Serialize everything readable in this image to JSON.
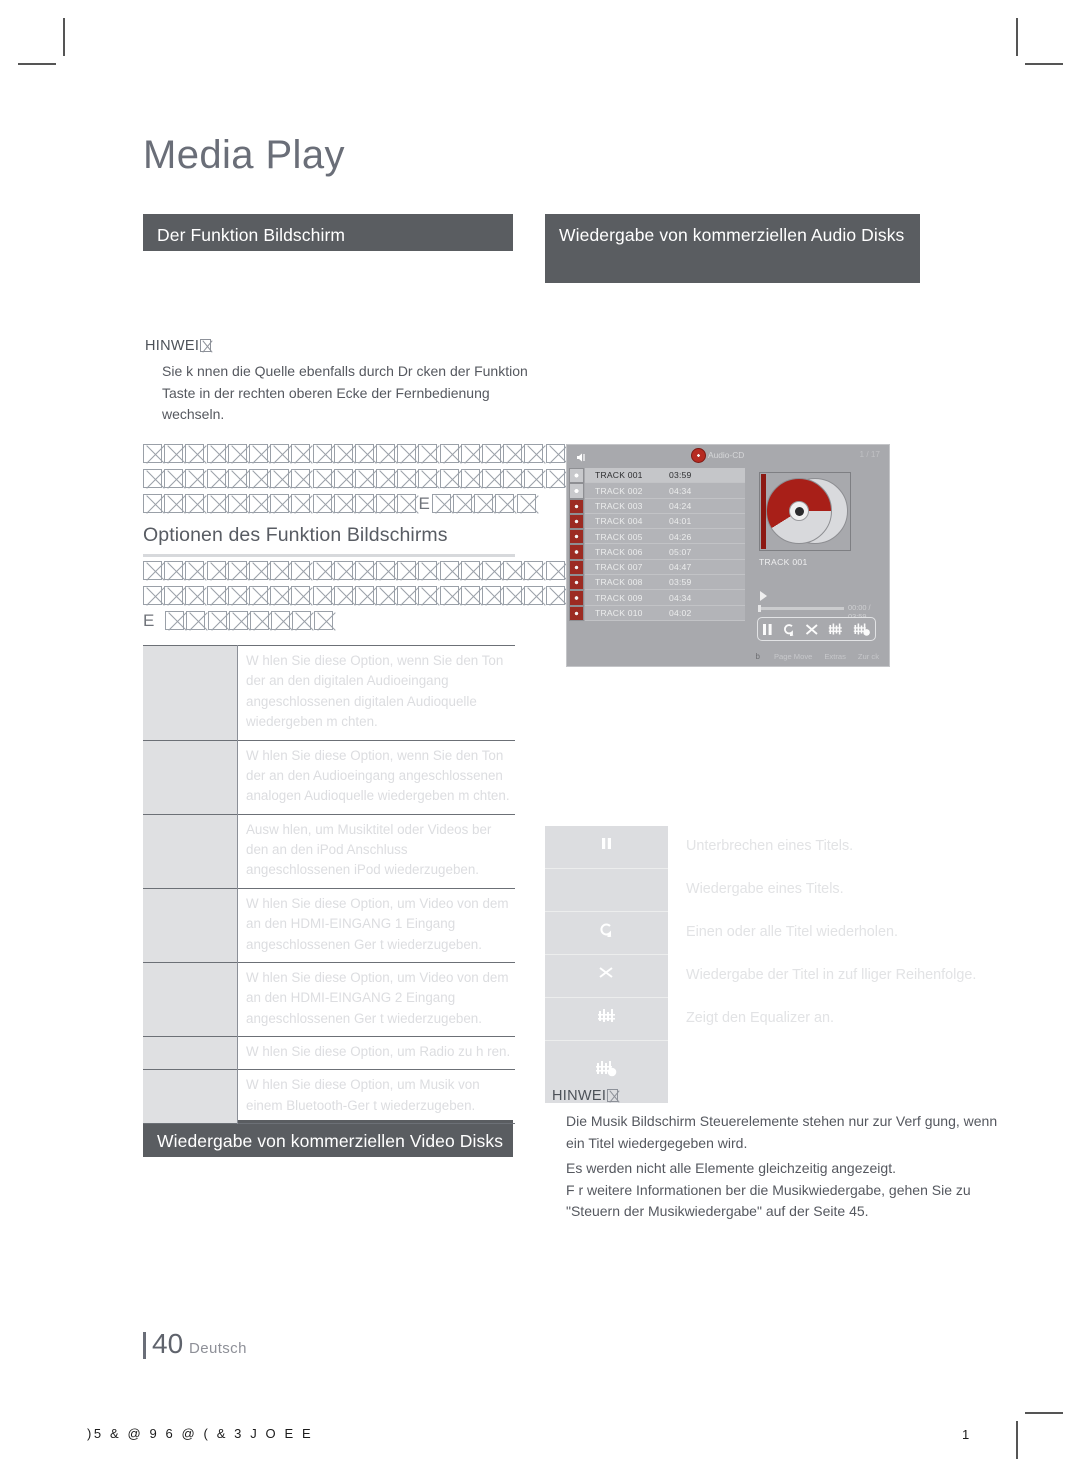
{
  "document": {
    "chapter_title": "Media Play",
    "footer": {
      "page_number": "40",
      "language": "Deutsch",
      "colophon": ")5  &      @ 9 6 @ ( & 3        J O E E",
      "sheet_number": "1"
    }
  },
  "sections": {
    "bar_funktion": "Der Funktion Bildschirm",
    "bar_audio": "Wiedergabe von kommerziellen Audio Disks",
    "bar_video": "Wiedergabe von kommerziellen Video Disks",
    "subhead_optionen": "Optionen des Funktion Bildschirms"
  },
  "notes": {
    "top": {
      "title": "HINWEI",
      "body": "Sie k nnen die Quelle ebenfalls durch Dr cken der Funktion Taste in der rechten oberen Ecke der Fernbedienung wechseln."
    },
    "bottom": {
      "title": "HINWEI",
      "line1": "Die Musik Bildschirm Steuerelemente stehen nur zur Verf gung, wenn ein Titel wiedergegeben wird.",
      "line2": "Es werden nicht alle Elemente gleichzeitig angezeigt.",
      "line3": "F r weitere Informationen  ber die Musikwiedergabe, gehen Sie zu \"Steuern der Musikwiedergabe\" auf der Seite 45."
    }
  },
  "tofu_blocks": {
    "block1": [
      {
        "boxes": 22,
        "letters": []
      },
      {
        "boxes": 23,
        "letters": []
      },
      {
        "boxes": 13,
        "letters": [
          "E"
        ],
        "boxes_after": 5
      }
    ],
    "block2": [
      {
        "boxes": 25,
        "letters": []
      },
      {
        "boxes": 22,
        "letters": []
      },
      {
        "boxes": 0,
        "letters": [
          "E"
        ],
        "boxes_after": 8
      }
    ]
  },
  "options_table": {
    "rows": [
      {
        "key": "",
        "desc": "W hlen Sie diese Option, wenn Sie den Ton der an den digitalen Audioeingang angeschlossenen digitalen Audioquelle wiedergeben m chten."
      },
      {
        "key": "",
        "desc": "W hlen Sie diese Option, wenn Sie den Ton der an den Audioeingang angeschlossenen analogen Audioquelle wiedergeben m chten."
      },
      {
        "key": "",
        "desc": "Ausw hlen, um Musiktitel oder Videos  ber den an den iPod Anschluss angeschlossenen iPod wiederzugeben."
      },
      {
        "key": "",
        "desc": "W hlen Sie diese Option, um Video von dem an den HDMI-EINGANG 1 Eingang angeschlossenen Ger t wiederzugeben."
      },
      {
        "key": "",
        "desc": "W hlen Sie diese Option, um Video von dem an den HDMI-EINGANG 2 Eingang angeschlossenen Ger t wiederzugeben."
      },
      {
        "key": "",
        "desc": "W hlen Sie diese Option, um Radio zu h ren."
      },
      {
        "key": "",
        "desc": "W hlen Sie diese Option, um Musik von einem Bluetooth-Ger t wiederzugeben."
      }
    ]
  },
  "music_controls": {
    "rows": [
      {
        "icon": "pause-icon",
        "desc": "Unterbrechen eines Titels."
      },
      {
        "icon": "play-icon",
        "desc": "Wiedergabe eines Titels."
      },
      {
        "icon": "repeat-icon",
        "desc": "Einen oder alle Titel wiederholen."
      },
      {
        "icon": "shuffle-icon",
        "desc": "Wiedergabe der Titel in zuf lliger Reihenfolge."
      },
      {
        "icon": "equalizer-icon",
        "desc": "Zeigt den Equalizer an."
      },
      {
        "icon": "equalizer-hand-icon",
        "desc": ""
      }
    ]
  },
  "device_screen": {
    "breadcrumb": "",
    "disc_label": "Audio-CD",
    "counter": "1 / 17",
    "tracks": [
      {
        "name": "TRACK 001",
        "time": "03:59"
      },
      {
        "name": "TRACK 002",
        "time": "04:34"
      },
      {
        "name": "TRACK 003",
        "time": "04:24"
      },
      {
        "name": "TRACK 004",
        "time": "04:01"
      },
      {
        "name": "TRACK 005",
        "time": "04:26"
      },
      {
        "name": "TRACK 006",
        "time": "05:07"
      },
      {
        "name": "TRACK 007",
        "time": "04:47"
      },
      {
        "name": "TRACK 008",
        "time": "03:59"
      },
      {
        "name": "TRACK 009",
        "time": "04:34"
      },
      {
        "name": "TRACK 010",
        "time": "04:02"
      }
    ],
    "now_playing": "TRACK 001",
    "time_display": "00:00 / 03:59",
    "bottom_keys": {
      "key_glyph": "b",
      "page_move": "Page Move",
      "extras": "Extras",
      "back": "Zur ck"
    }
  },
  "colors": {
    "bar_bg": "#5a5d61",
    "title_text": "#6a6e78",
    "device_bg": "#a8a9ad",
    "disc_red": "#a81f18"
  }
}
